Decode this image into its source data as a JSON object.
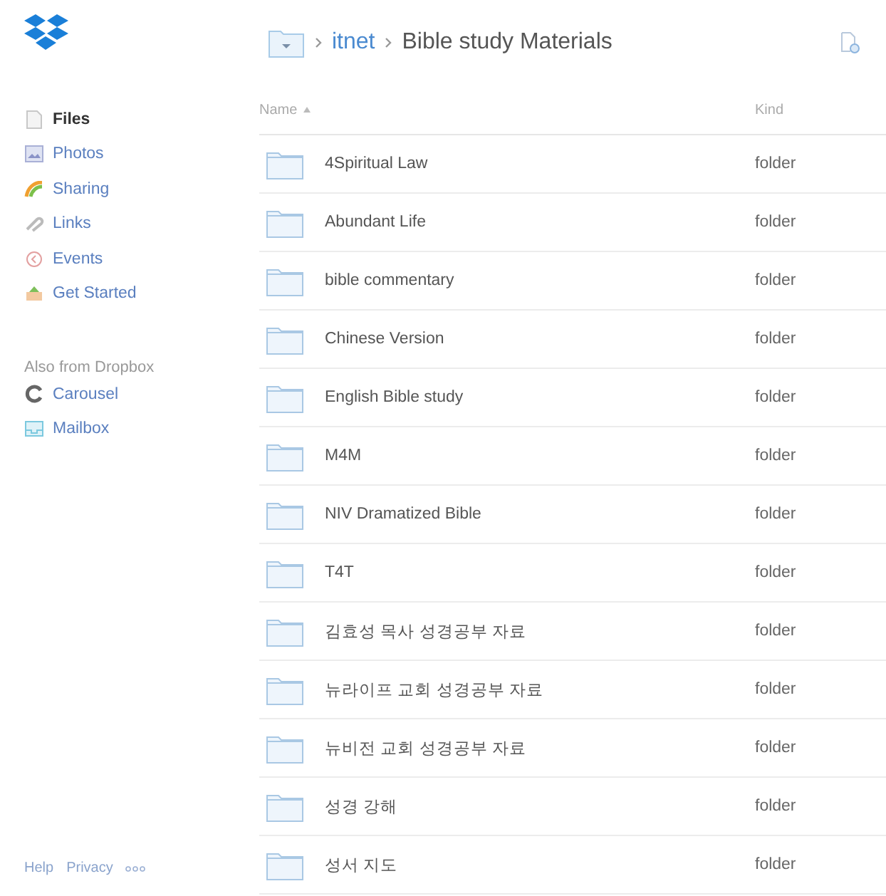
{
  "breadcrumb": [
    {
      "label": "itnet",
      "kind": "link"
    },
    {
      "label": "Bible study Materials",
      "kind": "current"
    }
  ],
  "sidebar": {
    "items": [
      {
        "label": "Files",
        "selected": true,
        "kind": "files"
      },
      {
        "label": "Photos",
        "selected": false,
        "kind": "photos"
      },
      {
        "label": "Sharing",
        "selected": false,
        "kind": "sharing"
      },
      {
        "label": "Links",
        "selected": false,
        "kind": "links"
      },
      {
        "label": "Events",
        "selected": false,
        "kind": "events"
      },
      {
        "label": "Get Started",
        "selected": false,
        "kind": "start"
      }
    ],
    "section_title": "Also from Dropbox",
    "also_items": [
      {
        "label": "Carousel",
        "kind": "carousel"
      },
      {
        "label": "Mailbox",
        "kind": "mailbox"
      }
    ],
    "footer": [
      "Help",
      "Privacy"
    ]
  },
  "table": {
    "columns": [
      {
        "label": "Name",
        "sorted": true
      },
      {
        "label": "Kind",
        "sorted": false
      }
    ],
    "rows": [
      {
        "name": "4Spiritual Law",
        "kind": "folder"
      },
      {
        "name": "Abundant Life",
        "kind": "folder"
      },
      {
        "name": "bible commentary",
        "kind": "folder"
      },
      {
        "name": "Chinese Version",
        "kind": "folder"
      },
      {
        "name": "English Bible study",
        "kind": "folder"
      },
      {
        "name": "M4M",
        "kind": "folder"
      },
      {
        "name": "NIV Dramatized Bible",
        "kind": "folder"
      },
      {
        "name": "T4T",
        "kind": "folder"
      },
      {
        "name": "김효성 목사 성경공부 자료",
        "kind": "folder"
      },
      {
        "name": "뉴라이프 교회 성경공부 자료",
        "kind": "folder"
      },
      {
        "name": "뉴비전 교회 성경공부 자료",
        "kind": "folder"
      },
      {
        "name": "성경 강해",
        "kind": "folder"
      },
      {
        "name": "성서 지도",
        "kind": "folder"
      }
    ]
  }
}
